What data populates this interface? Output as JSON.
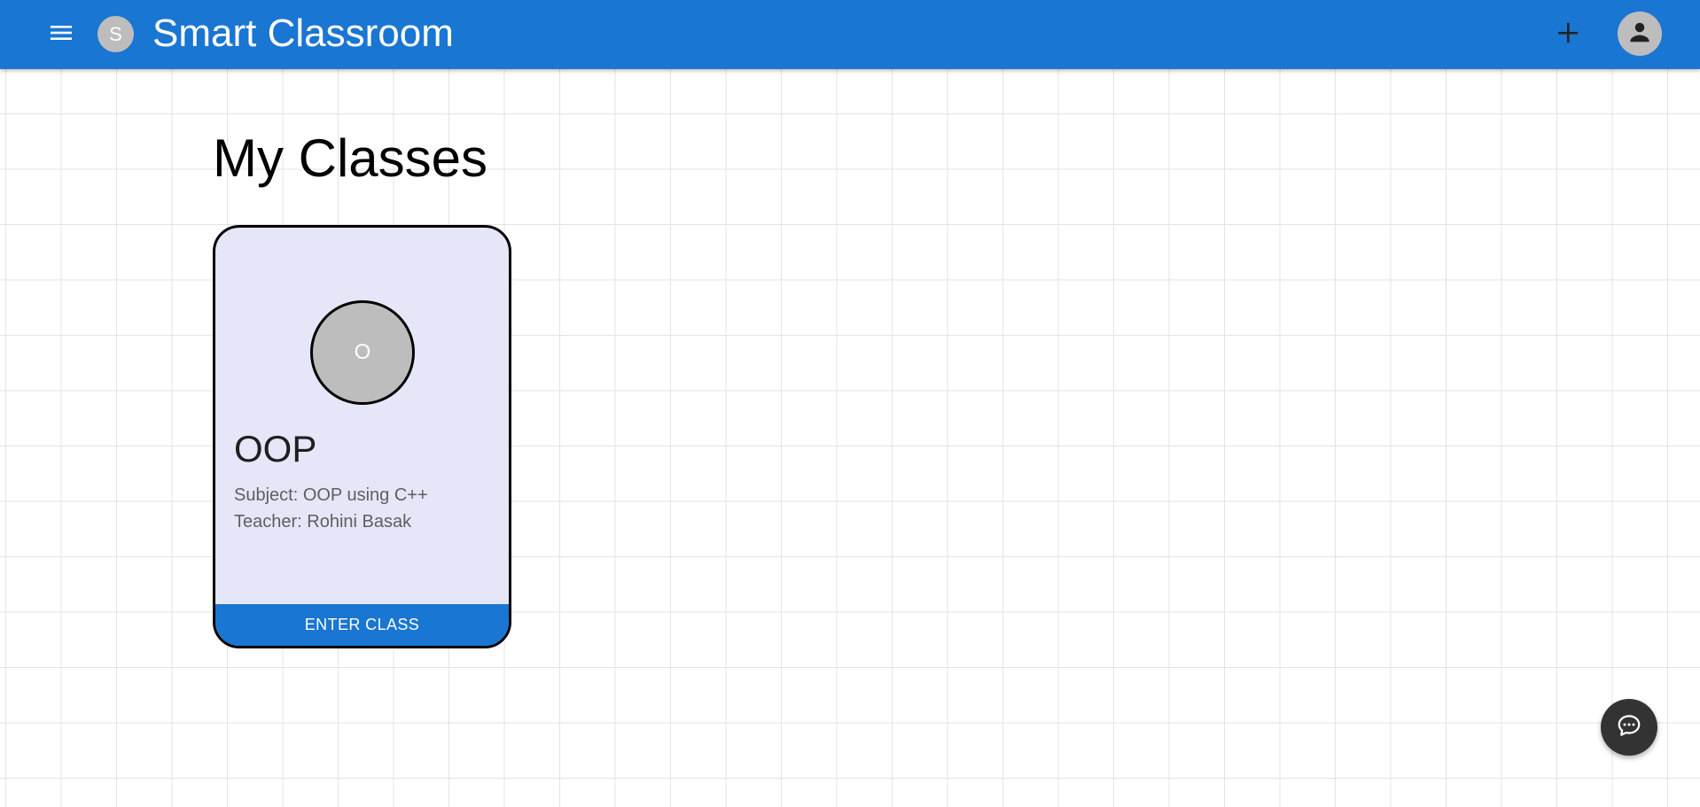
{
  "app": {
    "title": "Smart Classroom",
    "brand_initial": "S",
    "brand_color": "#1976d2"
  },
  "header": {
    "menu_icon": "menu-icon",
    "add_icon": "plus-icon",
    "account_icon": "account-icon"
  },
  "main": {
    "heading": "My Classes",
    "classes": [
      {
        "avatar_initial": "O",
        "name": "OOP",
        "subject": "Subject: OOP using C++",
        "teacher": "Teacher: Rohini Basak",
        "enter_label": "ENTER CLASS",
        "card_color": "#e5e6f8"
      }
    ]
  },
  "chat_fab": {
    "icon": "chat-bubble-icon",
    "color": "#333333"
  }
}
